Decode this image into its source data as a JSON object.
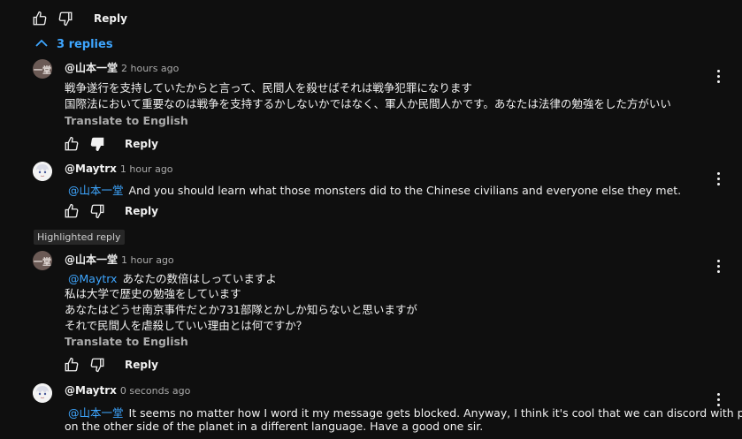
{
  "top_actions": {
    "reply_label": "Reply"
  },
  "replies_toggle": {
    "label": "3 replies"
  },
  "highlighted_label": "Highlighted reply",
  "comments": [
    {
      "avatar_text": "一堂",
      "author": "@山本一堂",
      "time": "2 hours ago",
      "lines": [
        "戦争遂行を支持していたからと言って、民間人を殺せばそれは戦争犯罪になります",
        "国際法において重要なのは戦争を支持するかしないかではなく、軍人か民間人かです。あなたは法律の勉強をした方がいい"
      ],
      "translate": "Translate to English",
      "reply_label": "Reply"
    },
    {
      "author": "@Maytrx",
      "time": "1 hour ago",
      "mention": "@山本一堂",
      "lines": [
        "And you should learn what those monsters did to the Chinese civilians and everyone else they met."
      ],
      "reply_label": "Reply"
    },
    {
      "avatar_text": "一堂",
      "author": "@山本一堂",
      "time": "1 hour ago",
      "mention": "@Maytrx",
      "lines": [
        "あなたの数倍はしっていますよ",
        "私は大学で歴史の勉強をしています",
        "あなたはどうせ南京事件だとか731部隊とかしか知らないと思いますが",
        "それで民間人を虐殺していい理由とは何ですか？"
      ],
      "translate": "Translate to English",
      "reply_label": "Reply"
    },
    {
      "author": "@Maytrx",
      "time": "0 seconds ago",
      "mention": "@山本一堂",
      "lines": [
        "It seems no matter how I word it my message gets blocked. Anyway, I think it's cool that we can discord with people",
        "on the other side of the planet in a different language. Have a good one sir."
      ]
    }
  ],
  "colors": {
    "background": "#0f0f0f",
    "link": "#3ea6ff",
    "muted": "#aaaaaa",
    "text": "#f1f1f1"
  }
}
